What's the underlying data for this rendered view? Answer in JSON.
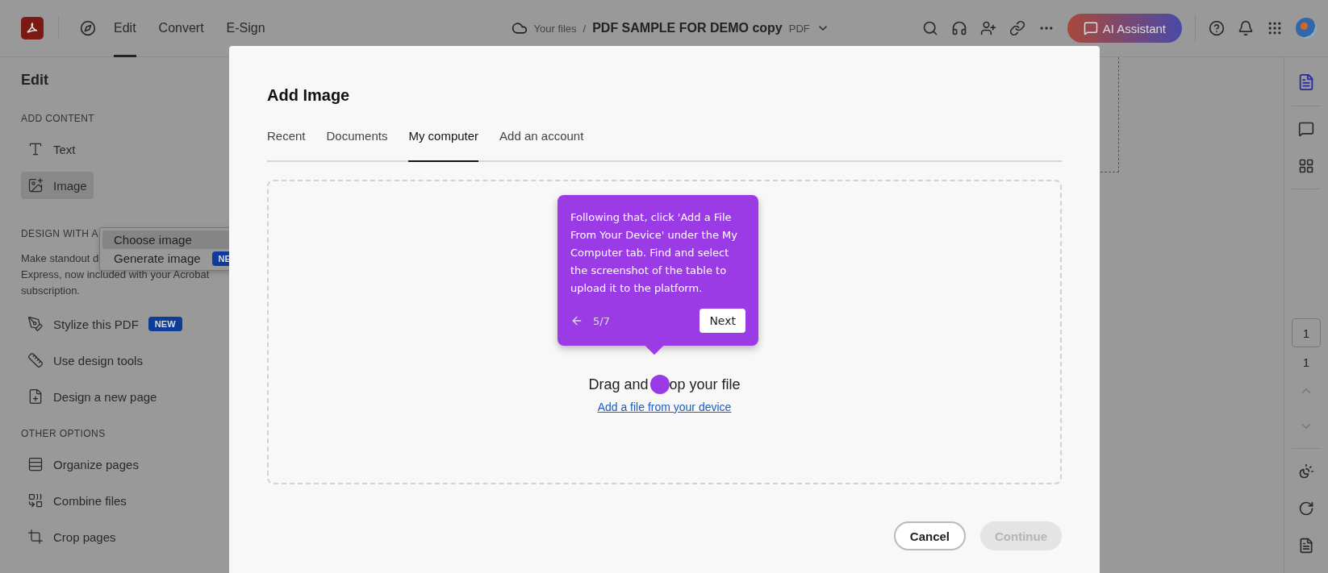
{
  "app_bar": {
    "nav": [
      {
        "label": "Edit",
        "selected": true
      },
      {
        "label": "Convert",
        "selected": false
      },
      {
        "label": "E-Sign",
        "selected": false
      }
    ],
    "breadcrumb": {
      "root": "Your files",
      "separator": "/",
      "file_name": "PDF SAMPLE FOR DEMO copy",
      "file_type": "PDF"
    },
    "ai_button": "AI Assistant"
  },
  "sidebar": {
    "title": "Edit",
    "sections": [
      {
        "heading": "ADD CONTENT",
        "items": [
          {
            "label": "Text",
            "selected": false
          },
          {
            "label": "Image",
            "selected": true
          }
        ]
      },
      {
        "heading": "DESIGN WITH A",
        "description_lines": [
          "Make standout d",
          "Express, now included with your Acrobat",
          "subscription."
        ],
        "items": [
          {
            "label": "Stylize this PDF",
            "badge": "NEW",
            "selected": false
          },
          {
            "label": "Use design tools",
            "selected": false
          },
          {
            "label": "Design a new page",
            "selected": false
          }
        ]
      },
      {
        "heading": "OTHER OPTIONS",
        "items": [
          {
            "label": "Organize pages",
            "selected": false
          },
          {
            "label": "Combine files",
            "selected": false
          },
          {
            "label": "Crop pages",
            "selected": false
          }
        ]
      }
    ]
  },
  "image_menu": [
    {
      "label": "Choose image",
      "selected": true
    },
    {
      "label": "Generate image",
      "badge": "NE",
      "selected": false
    }
  ],
  "right_rail": {
    "page_input": "1",
    "page_count": "1"
  },
  "dialog": {
    "title": "Add Image",
    "tabs": [
      {
        "label": "Recent",
        "selected": false
      },
      {
        "label": "Documents",
        "selected": false
      },
      {
        "label": "My computer",
        "selected": true
      },
      {
        "label": "Add an account",
        "selected": false
      }
    ],
    "drop_text_before": "Drag and",
    "drop_text_after": "op your file",
    "link": "Add a file from your device",
    "buttons": [
      {
        "label": "Cancel",
        "disabled": false
      },
      {
        "label": "Continue",
        "disabled": true
      }
    ]
  },
  "tour": {
    "text": "Following that, click 'Add a File From Your Device' under the My Computer tab. Find and select the screenshot of the table to upload it to the platform.",
    "step": "5/7",
    "next": "Next"
  }
}
